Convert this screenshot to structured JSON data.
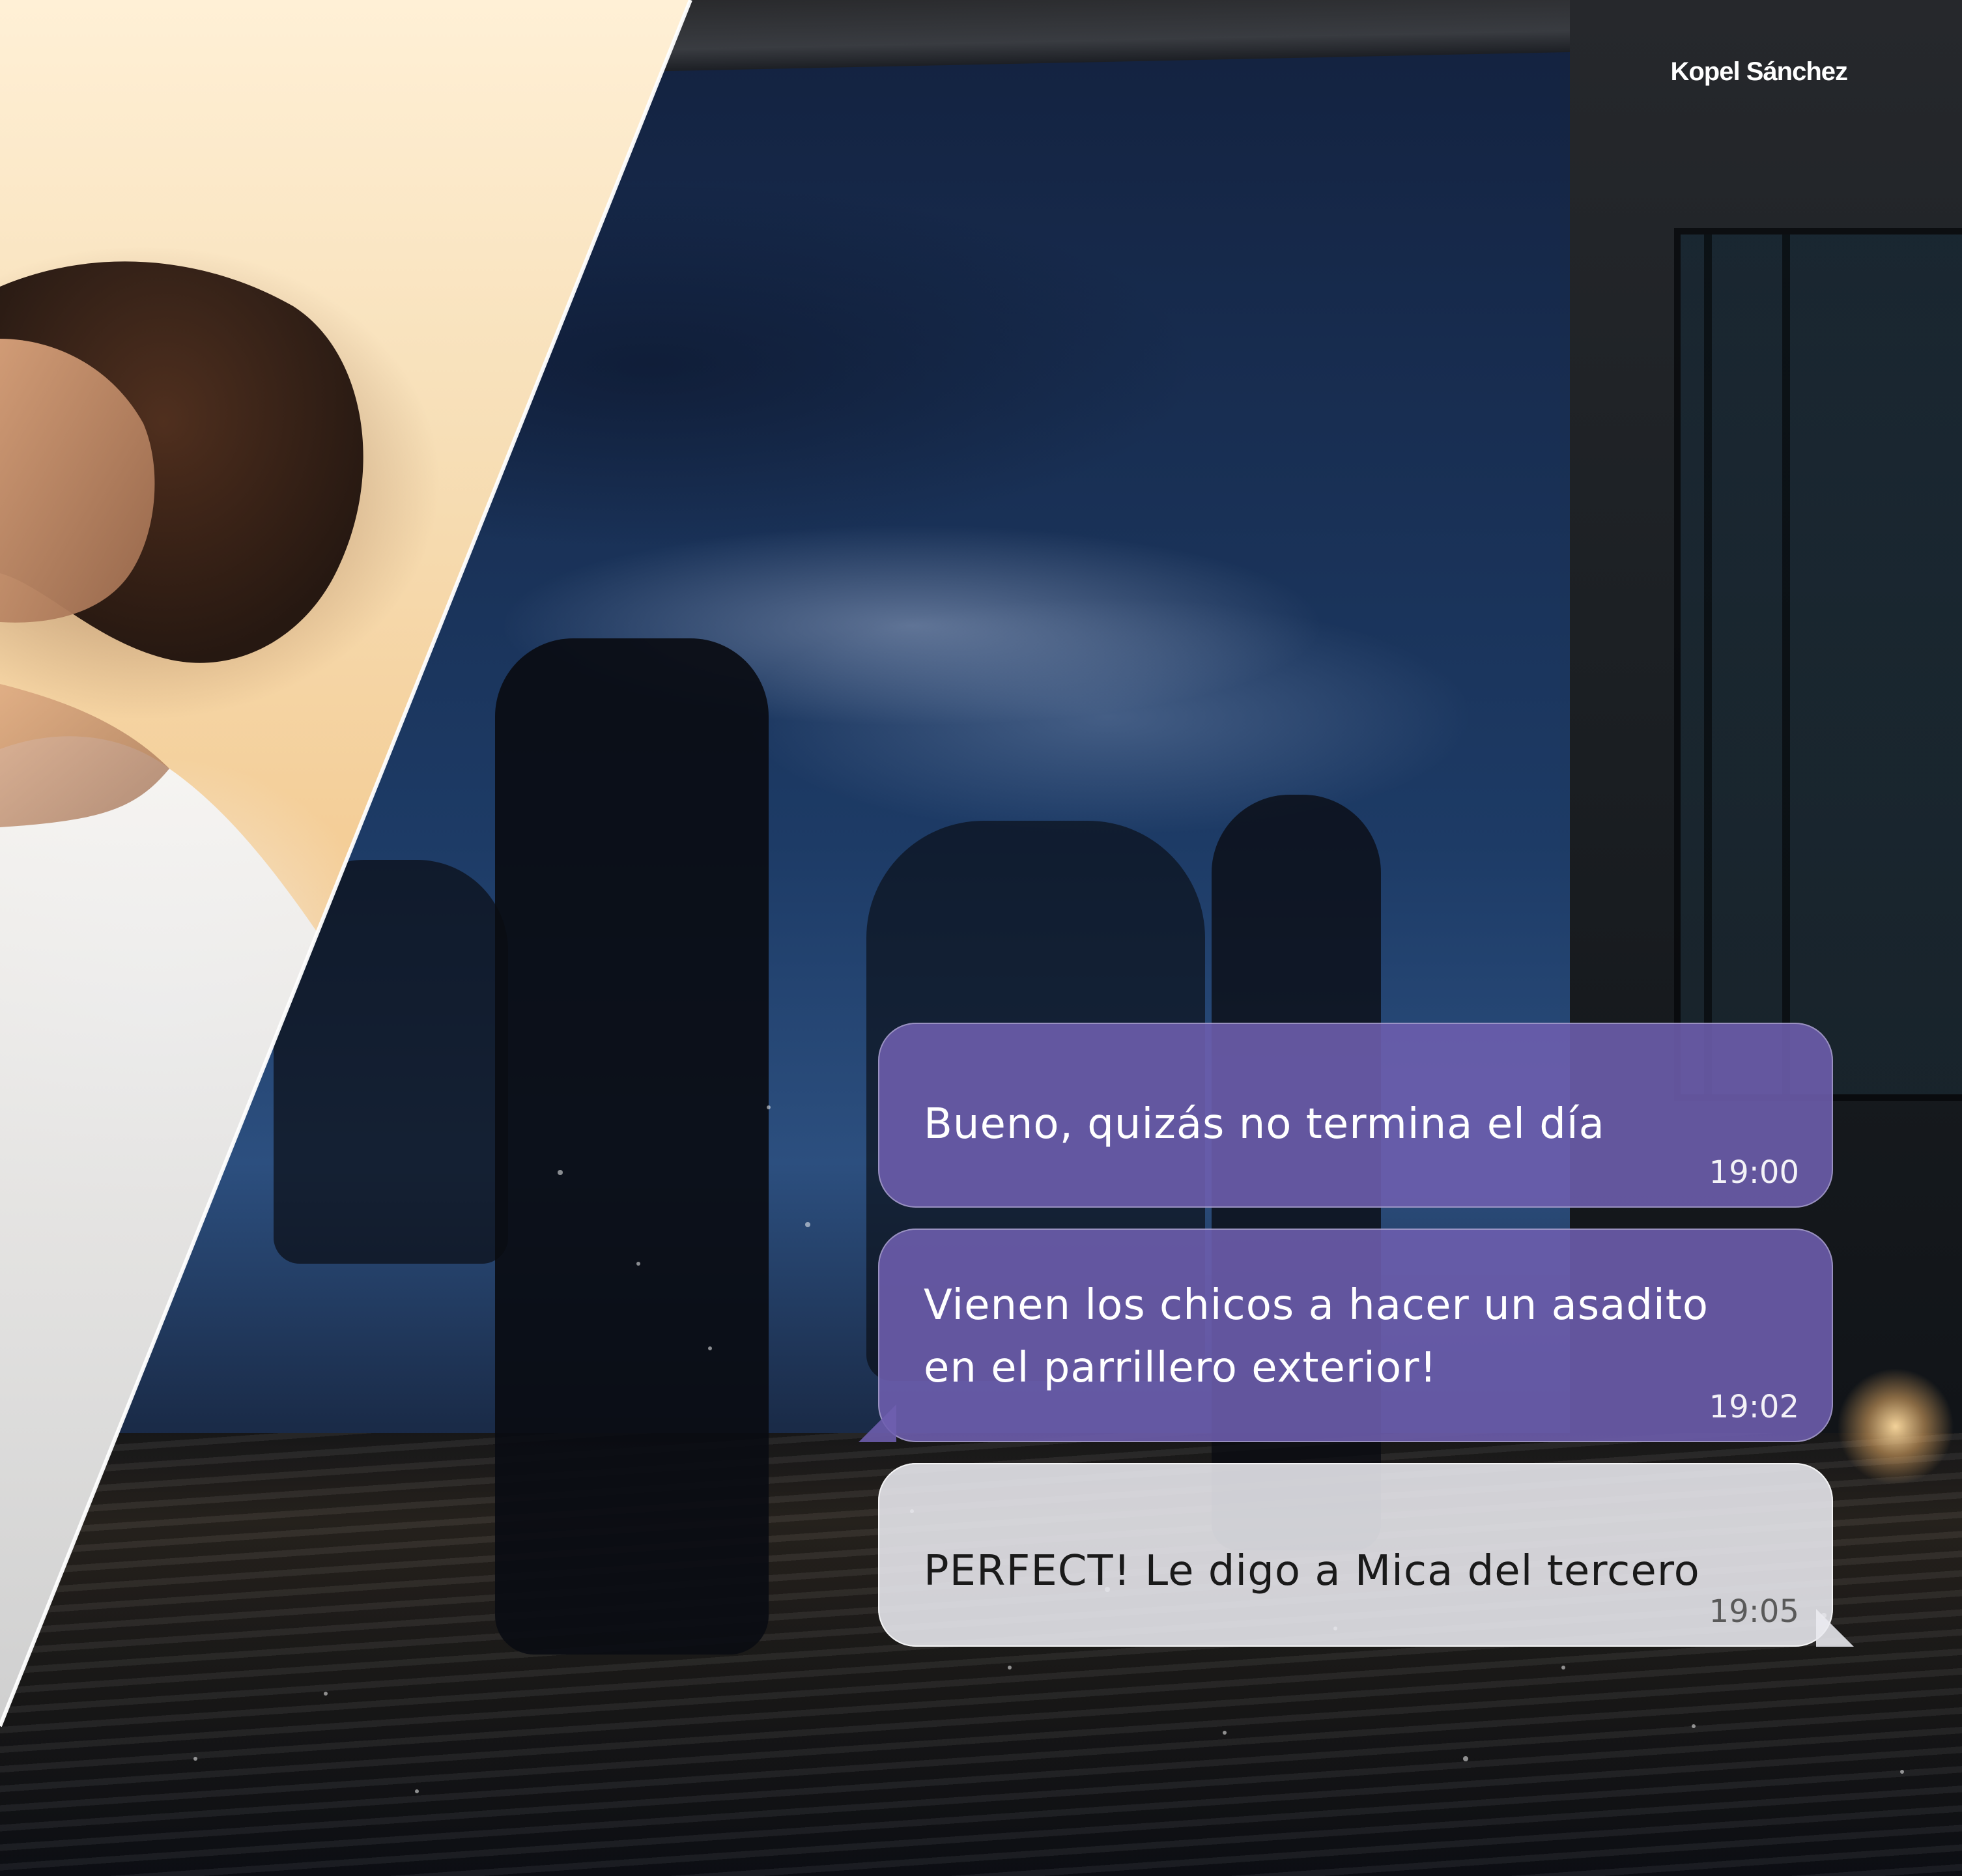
{
  "brand": {
    "name": "Kopel Sánchez"
  },
  "chat": {
    "messages": [
      {
        "text": "Bueno, quizás no termina el día",
        "time": "19:00",
        "style": "purple"
      },
      {
        "text": "Vienen los chicos a hacer un asadito\nen el parrillero exterior!",
        "time": "19:02",
        "style": "purple"
      },
      {
        "text": "PERFECT! Le digo a Mica del tercero",
        "time": "19:05",
        "style": "light"
      }
    ]
  },
  "colors": {
    "purple_bubble": "#6E5FAF",
    "light_bubble": "#EBEBF0",
    "brand_text": "#FFFFFF"
  }
}
